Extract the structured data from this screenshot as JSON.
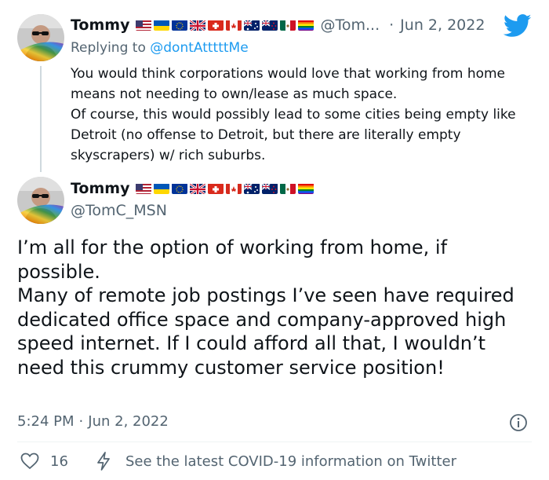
{
  "quoted_tweet": {
    "author_name": "Tommy",
    "handle": "@Tom...",
    "separator": "·",
    "date": "Jun 2, 2022",
    "reply_prefix": "Replying to",
    "reply_handle": "@dontAtttttMe",
    "text": "You would think corporations would love that working from home means not needing to own/lease as much space.\nOf course, this would possibly lead to some cities being empty like Detroit (no offense to Detroit, but there are literally empty skyscrapers) w/ rich suburbs."
  },
  "main_tweet": {
    "author_name": "Tommy",
    "handle": "@TomC_MSN",
    "text": "I’m all for the option of working from home, if possible.\nMany of remote job postings I’ve seen have required dedicated office space and company-approved high speed internet. If I could afford all that, I wouldn’t need this crummy customer service position!",
    "time": "5:24 PM",
    "separator": "·",
    "date": "Jun 2, 2022"
  },
  "footer": {
    "likes": "16",
    "covid_notice": "See the latest COVID-19 information on Twitter"
  },
  "flags": [
    "us-flag",
    "ukraine-flag",
    "eu-flag",
    "uk-flag",
    "switzerland-flag",
    "canada-flag",
    "australia-flag",
    "new-zealand-flag",
    "mexico-flag",
    "rainbow-flag"
  ],
  "colors": {
    "twitter_blue": "#1d9bf0",
    "secondary_text": "#536471",
    "primary_text": "#0f1419",
    "thread_line": "#cfd9de"
  }
}
